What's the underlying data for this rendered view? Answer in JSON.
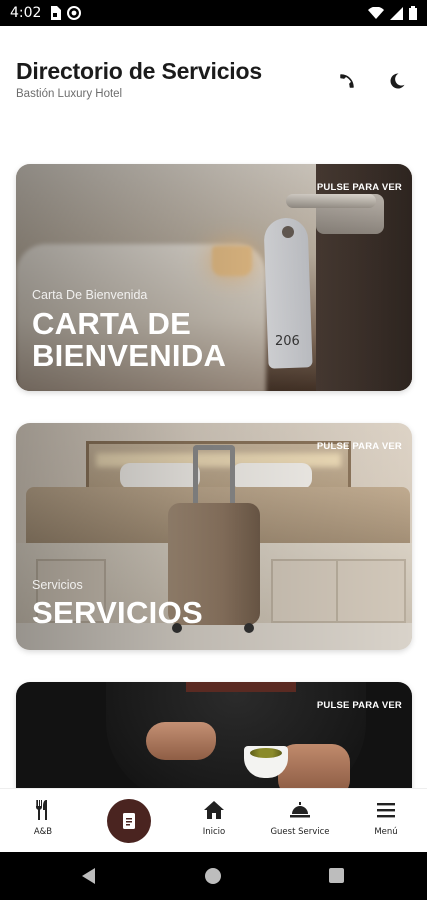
{
  "status_bar": {
    "time": "4:02"
  },
  "header": {
    "title": "Directorio de Servicios",
    "subtitle": "Bastión Luxury Hotel"
  },
  "cards": [
    {
      "tap_hint": "PULSE PARA VER",
      "small_label": "Carta De Bienvenida",
      "big_label_line1": "CARTA DE",
      "big_label_line2": "BIENVENIDA",
      "room_number": "206"
    },
    {
      "tap_hint": "PULSE PARA VER",
      "small_label": "Servicios",
      "big_label": "SERVICIOS"
    },
    {
      "tap_hint": "PULSE PARA VER"
    }
  ],
  "bottom_nav": {
    "items": [
      {
        "label": "A&B",
        "icon": "cutlery-icon"
      },
      {
        "label": "",
        "icon": "document-icon"
      },
      {
        "label": "Inicio",
        "icon": "home-icon"
      },
      {
        "label": "Guest Service",
        "icon": "service-bell-icon"
      },
      {
        "label": "Menú",
        "icon": "hamburger-menu-icon"
      }
    ],
    "center_color": "#4a2420"
  }
}
